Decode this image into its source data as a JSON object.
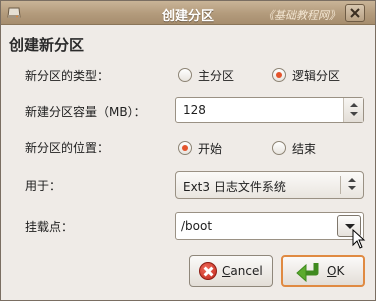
{
  "window": {
    "title": "创建分区",
    "watermark": "《基础教程网》"
  },
  "dialog": {
    "heading": "创建新分区"
  },
  "form": {
    "type_label": "新分区的类型：",
    "type_options": [
      "主分区",
      "逻辑分区"
    ],
    "type_selected": "逻辑分区",
    "size_label": "新建分区容量（MB）：",
    "size_value": "128",
    "position_label": "新分区的位置：",
    "position_options": [
      "开始",
      "结束"
    ],
    "position_selected": "开始",
    "use_label": "用于：",
    "use_value": "Ext3 日志文件系统",
    "mount_label": "挂载点：",
    "mount_value": "/boot"
  },
  "buttons": {
    "cancel_prefix": "C",
    "cancel_rest": "ancel",
    "ok_prefix": "O",
    "ok_rest": "K"
  },
  "colors": {
    "titlebar": "#b39b7c",
    "accent": "#e4542c",
    "ok_border": "#e08a42"
  },
  "icons": {
    "app": "drive-icon",
    "close": "close-icon",
    "cancel": "cancel-icon",
    "ok": "ok-arrow-icon"
  }
}
